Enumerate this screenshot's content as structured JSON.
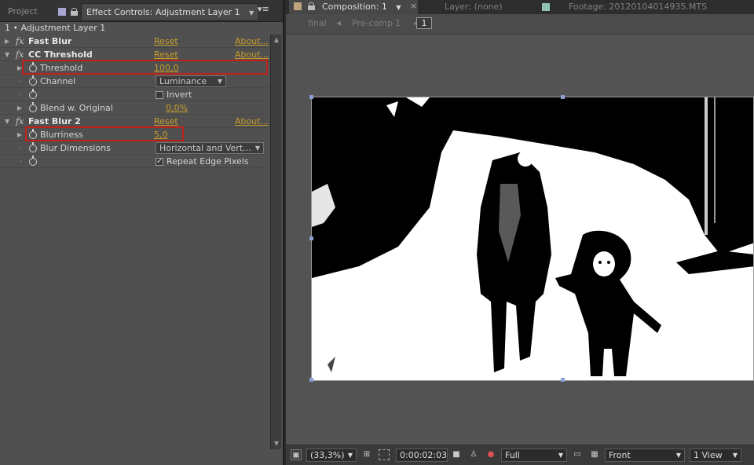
{
  "left_panel": {
    "tabs": {
      "project": "Project",
      "effect_controls": "Effect Controls: Adjustment Layer 1"
    },
    "layer_label": "1 • Adjustment Layer 1",
    "effects": [
      {
        "name": "Fast Blur",
        "reset": "Reset",
        "about": "About..."
      },
      {
        "name": "CC Threshold",
        "reset": "Reset",
        "about": "About...",
        "props": {
          "threshold": {
            "label": "Threshold",
            "value": "100,0"
          },
          "channel": {
            "label": "Channel",
            "value": "Luminance"
          },
          "invert": {
            "label": "Invert",
            "checked": false
          },
          "blend": {
            "label": "Blend w. Original",
            "value": "0,0%"
          }
        }
      },
      {
        "name": "Fast Blur 2",
        "reset": "Reset",
        "about": "About...",
        "props": {
          "blurriness": {
            "label": "Blurriness",
            "value": "5,0"
          },
          "blur_dimensions": {
            "label": "Blur Dimensions",
            "value": "Horizontal and Vert..."
          },
          "repeat_edge": {
            "label": "Repeat Edge Pixels",
            "checked": true
          }
        }
      }
    ]
  },
  "right_panel": {
    "tabs": {
      "composition": "Composition: 1",
      "layer": "Layer: (none)",
      "footage": "Footage: 20120104014935.MTS"
    },
    "flowchart": {
      "items": [
        "final",
        "Pre-comp 1"
      ],
      "current": "1"
    },
    "status": {
      "zoom": "(33,3%)",
      "timecode": "0:00:02:03",
      "resolution": "Full",
      "view": "Front",
      "views_count": "1 View"
    }
  },
  "colors": {
    "link": "#c99d2a",
    "highlight": "#c0201a",
    "panel_bg": "#505050"
  }
}
